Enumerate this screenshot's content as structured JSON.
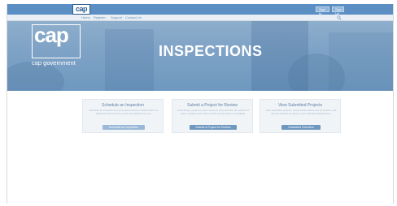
{
  "topbar": {
    "logo_text": "cap",
    "signin_label": "Sign In",
    "signup_label": "Sign Up"
  },
  "nav": {
    "items": [
      "Home",
      "Register",
      "Support",
      "Contact Us"
    ]
  },
  "hero": {
    "logo_text": "cap",
    "subtitle": "cap government",
    "title": "INSPECTIONS"
  },
  "cards": [
    {
      "title": "Schedule an Inspection",
      "description": "Schedule an inspection for your permit and be notified when it is performed and how the results are delivered to you.",
      "button": "Schedule an Inspection"
    },
    {
      "title": "Submit a Project for Review",
      "description": "Submitting a project for plan review is easy and fast. Be notified of status updates and review results as they become available.",
      "button": "Submit a Project for Review"
    },
    {
      "title": "View Submitted Projects",
      "description": "View submitted projects, check review status and comments, and see the timeline for each of your submitted applications.",
      "button": "Submitted Overview"
    }
  ],
  "colors": {
    "topbar": "#5b8fc4",
    "hero": "#7fa3c6",
    "card": "#f1f4f7",
    "button": "#9ab9d8"
  }
}
